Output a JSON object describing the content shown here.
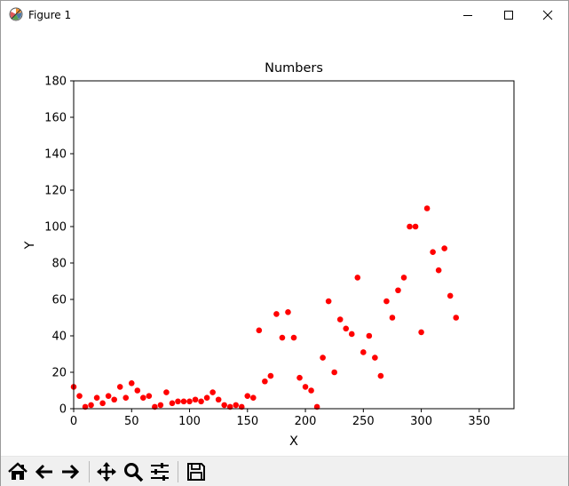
{
  "window": {
    "title": "Figure 1"
  },
  "chart_data": {
    "type": "scatter",
    "title": "Numbers",
    "xlabel": "X",
    "ylabel": "Y",
    "xlim": [
      0,
      380
    ],
    "ylim": [
      0,
      180
    ],
    "xticks": [
      0,
      50,
      100,
      150,
      200,
      250,
      300,
      350
    ],
    "yticks": [
      0,
      20,
      40,
      60,
      80,
      100,
      120,
      140,
      160,
      180
    ],
    "xtick_labels": [
      "0",
      "50",
      "100",
      "150",
      "200",
      "250",
      "300",
      "350"
    ],
    "ytick_labels": [
      "0",
      "20",
      "40",
      "60",
      "80",
      "100",
      "120",
      "140",
      "160",
      "180"
    ],
    "marker_color": "#ff0000",
    "points": [
      [
        0,
        12
      ],
      [
        5,
        7
      ],
      [
        10,
        1
      ],
      [
        15,
        2
      ],
      [
        20,
        6
      ],
      [
        25,
        3
      ],
      [
        30,
        7
      ],
      [
        35,
        5
      ],
      [
        40,
        12
      ],
      [
        45,
        6
      ],
      [
        50,
        14
      ],
      [
        55,
        10
      ],
      [
        60,
        6
      ],
      [
        65,
        7
      ],
      [
        70,
        1
      ],
      [
        75,
        2
      ],
      [
        80,
        9
      ],
      [
        85,
        3
      ],
      [
        90,
        4
      ],
      [
        95,
        4
      ],
      [
        100,
        4
      ],
      [
        105,
        5
      ],
      [
        110,
        4
      ],
      [
        115,
        6
      ],
      [
        120,
        9
      ],
      [
        125,
        5
      ],
      [
        130,
        2
      ],
      [
        135,
        1
      ],
      [
        140,
        2
      ],
      [
        145,
        1
      ],
      [
        150,
        7
      ],
      [
        155,
        6
      ],
      [
        160,
        43
      ],
      [
        165,
        15
      ],
      [
        170,
        18
      ],
      [
        175,
        52
      ],
      [
        180,
        39
      ],
      [
        185,
        53
      ],
      [
        190,
        39
      ],
      [
        195,
        17
      ],
      [
        200,
        12
      ],
      [
        205,
        10
      ],
      [
        210,
        1
      ],
      [
        215,
        28
      ],
      [
        220,
        59
      ],
      [
        225,
        20
      ],
      [
        230,
        49
      ],
      [
        235,
        44
      ],
      [
        240,
        41
      ],
      [
        245,
        72
      ],
      [
        250,
        31
      ],
      [
        255,
        40
      ],
      [
        260,
        28
      ],
      [
        265,
        18
      ],
      [
        270,
        59
      ],
      [
        275,
        50
      ],
      [
        280,
        65
      ],
      [
        285,
        72
      ],
      [
        290,
        100
      ],
      [
        295,
        100
      ],
      [
        300,
        42
      ],
      [
        305,
        110
      ],
      [
        310,
        86
      ],
      [
        315,
        76
      ],
      [
        320,
        88
      ],
      [
        325,
        62
      ],
      [
        330,
        50
      ]
    ]
  },
  "toolbar": {
    "buttons": [
      {
        "name": "home-button",
        "icon": "home-icon"
      },
      {
        "name": "back-button",
        "icon": "arrow-left-icon"
      },
      {
        "name": "forward-button",
        "icon": "arrow-right-icon"
      },
      {
        "name": "pan-button",
        "icon": "move-icon"
      },
      {
        "name": "zoom-button",
        "icon": "magnifier-icon"
      },
      {
        "name": "configure-subplots-button",
        "icon": "sliders-icon"
      },
      {
        "name": "save-button",
        "icon": "floppy-icon"
      }
    ]
  }
}
